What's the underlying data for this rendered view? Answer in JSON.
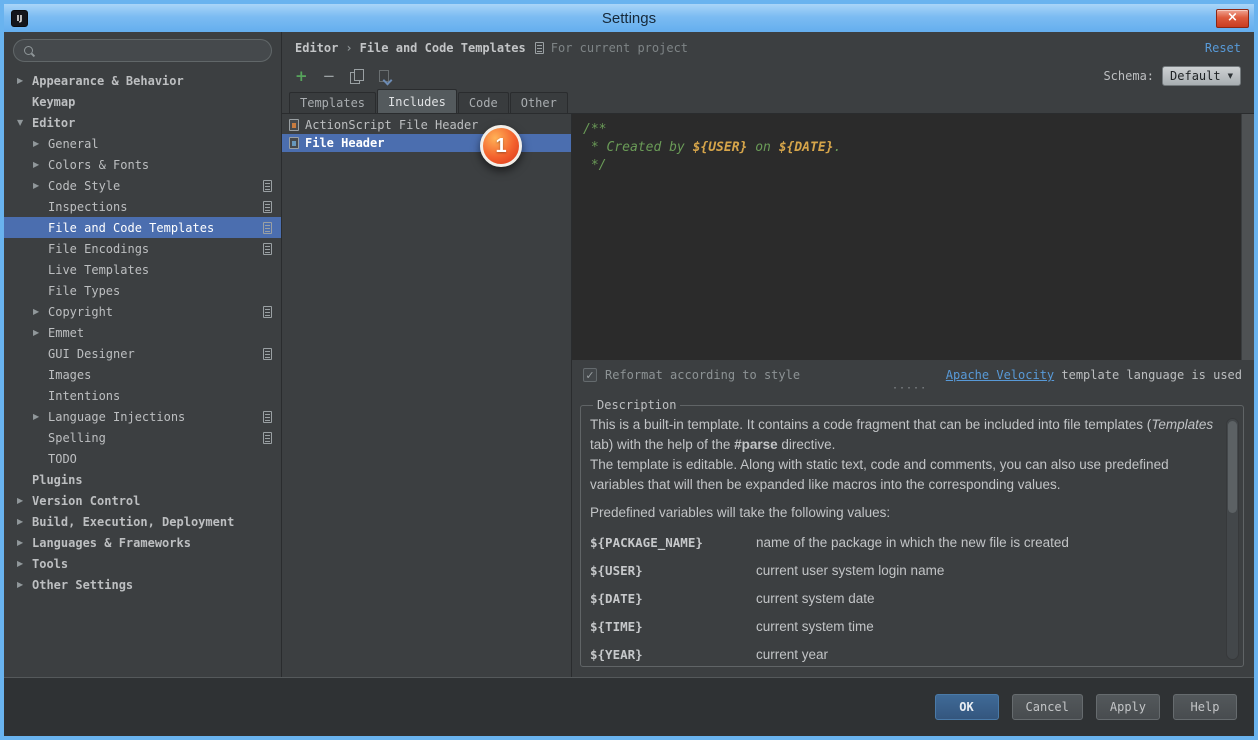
{
  "window": {
    "title": "Settings"
  },
  "colors": {
    "titlebar_blue": "#69b3ef",
    "panel_background": "#3c3f41",
    "editor_background": "#2b2b2b",
    "selection_blue": "#4b6eaf",
    "link_blue": "#589ad8",
    "comment_green": "#6a9b57",
    "variable_orange": "#d6a54a",
    "close_button_red": "#dd5a3c",
    "annotation_red": "#e8481c"
  },
  "icons": {
    "app": "IJ",
    "close": "×",
    "chevron_collapsed": "▶",
    "chevron_expanded": "▼",
    "add": "+",
    "remove": "−",
    "dropdown_arrow": "▼",
    "check": "✓",
    "grip_dots": "·····",
    "search": "css-magnifier",
    "copy": "css-two-pages",
    "reset_to_default": "css-page-arrow",
    "per_project_page": "css-page"
  },
  "sidebar": {
    "search_value": "",
    "items": [
      {
        "label": "Appearance & Behavior",
        "state": "collapsed"
      },
      {
        "label": "Keymap"
      },
      {
        "label": "Editor",
        "state": "expanded"
      },
      {
        "label": "General",
        "state": "collapsed"
      },
      {
        "label": "Colors & Fonts",
        "state": "collapsed"
      },
      {
        "label": "Code Style",
        "state": "collapsed",
        "per_project": true
      },
      {
        "label": "Inspections",
        "per_project": true
      },
      {
        "label": "File and Code Templates",
        "per_project": true,
        "selected": true
      },
      {
        "label": "File Encodings",
        "per_project": true
      },
      {
        "label": "Live Templates"
      },
      {
        "label": "File Types"
      },
      {
        "label": "Copyright",
        "state": "collapsed",
        "per_project": true
      },
      {
        "label": "Emmet",
        "state": "collapsed"
      },
      {
        "label": "GUI Designer",
        "per_project": true
      },
      {
        "label": "Images"
      },
      {
        "label": "Intentions"
      },
      {
        "label": "Language Injections",
        "state": "collapsed",
        "per_project": true
      },
      {
        "label": "Spelling",
        "per_project": true
      },
      {
        "label": "TODO"
      },
      {
        "label": "Plugins"
      },
      {
        "label": "Version Control",
        "state": "collapsed"
      },
      {
        "label": "Build, Execution, Deployment",
        "state": "collapsed"
      },
      {
        "label": "Languages & Frameworks",
        "state": "collapsed"
      },
      {
        "label": "Tools",
        "state": "collapsed"
      },
      {
        "label": "Other Settings",
        "state": "collapsed"
      }
    ]
  },
  "header": {
    "breadcrumb": [
      "Editor",
      "File and Code Templates"
    ],
    "breadcrumb_separator": "›",
    "scope_note": "For current project",
    "reset_link": "Reset"
  },
  "toolbar": {
    "schema_label": "Schema:",
    "schema_value": "Default"
  },
  "tabs": {
    "items": [
      {
        "label": "Templates"
      },
      {
        "label": "Includes",
        "active": true
      },
      {
        "label": "Code"
      },
      {
        "label": "Other"
      }
    ]
  },
  "includes_list": {
    "items": [
      {
        "label": "ActionScript File Header"
      },
      {
        "label": "File Header",
        "selected": true
      }
    ]
  },
  "annotation": {
    "label": "1"
  },
  "editor": {
    "l1": "/**",
    "l2a": " * Created by ",
    "l2b": "${USER}",
    "l2c": " on ",
    "l2d": "${DATE}",
    "l2e": ".",
    "l3": " */"
  },
  "reformat": {
    "label": "Reformat according to style",
    "checked": true,
    "link_text": "Apache Velocity",
    "suffix_text": " template language is used"
  },
  "description": {
    "title": "Description",
    "p1a": "This is a built-in template. It contains a code fragment that can be included into file templates (",
    "p1b": "Templates",
    "p1c": " tab) with the help of the ",
    "p1d": "#parse",
    "p1e": " directive.",
    "p2": "The template is editable. Along with static text, code and comments, you can also use predefined variables that will then be expanded like macros into the corresponding values.",
    "p3": "Predefined variables will take the following values:",
    "variables": [
      {
        "name": "${PACKAGE_NAME}",
        "value": "name of the package in which the new file is created"
      },
      {
        "name": "${USER}",
        "value": "current user system login name"
      },
      {
        "name": "${DATE}",
        "value": "current system date"
      },
      {
        "name": "${TIME}",
        "value": "current system time"
      },
      {
        "name": "${YEAR}",
        "value": "current year"
      }
    ]
  },
  "buttons": {
    "ok": "OK",
    "cancel": "Cancel",
    "apply": "Apply",
    "help": "Help"
  }
}
